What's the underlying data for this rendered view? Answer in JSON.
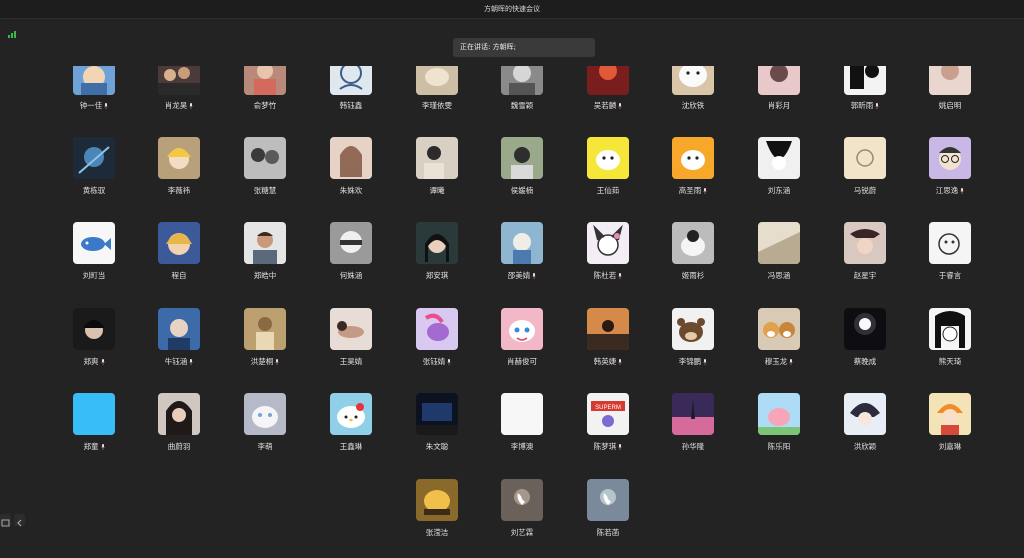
{
  "window": {
    "title": "方朝晖的快速会议"
  },
  "speaking": {
    "label": "正在讲话: 方朝晖;"
  },
  "participants": [
    {
      "name": "钟一佳",
      "mic": true,
      "avatar": "cartoon-photo"
    },
    {
      "name": "肖龙昊",
      "mic": true,
      "avatar": "group-photo"
    },
    {
      "name": "俞梦竹",
      "mic": false,
      "avatar": "person-photo"
    },
    {
      "name": "韩钰鑫",
      "mic": false,
      "avatar": "sketch-drawing"
    },
    {
      "name": "李瑾依雯",
      "mic": false,
      "avatar": "cat-photo"
    },
    {
      "name": "魏雪颖",
      "mic": false,
      "avatar": "grey-photo"
    },
    {
      "name": "吴若麟",
      "mic": true,
      "avatar": "red-photo"
    },
    {
      "name": "沈欣铁",
      "mic": false,
      "avatar": "white-dog"
    },
    {
      "name": "肖彩月",
      "mic": false,
      "avatar": "pink-photo"
    },
    {
      "name": "郭昕雨",
      "mic": true,
      "avatar": "black-white-drawing"
    },
    {
      "name": "姚启明",
      "mic": false,
      "avatar": "light-photo"
    },
    {
      "name": "黄栋驭",
      "mic": false,
      "avatar": "blue-dark-photo"
    },
    {
      "name": "李薇祎",
      "mic": false,
      "avatar": "yellow-hair-anime"
    },
    {
      "name": "张糖慧",
      "mic": false,
      "avatar": "couple-photo"
    },
    {
      "name": "朱姝欢",
      "mic": false,
      "avatar": "girl-photo"
    },
    {
      "name": "谭曦",
      "mic": false,
      "avatar": "person-selfie"
    },
    {
      "name": "侯媛楠",
      "mic": false,
      "avatar": "girl-green"
    },
    {
      "name": "王仙茹",
      "mic": false,
      "avatar": "yellow-cartoon"
    },
    {
      "name": "高圣雨",
      "mic": true,
      "avatar": "orange-cartoon"
    },
    {
      "name": "刘东涵",
      "mic": false,
      "avatar": "manga-face"
    },
    {
      "name": "马锐蔚",
      "mic": false,
      "avatar": "beige-doodle"
    },
    {
      "name": "江思逸",
      "mic": true,
      "avatar": "glasses-drawing"
    },
    {
      "name": "刘町当",
      "mic": false,
      "avatar": "blue-fish"
    },
    {
      "name": "程自",
      "mic": false,
      "avatar": "cartoon-girl"
    },
    {
      "name": "郑皓中",
      "mic": false,
      "avatar": "man-photo"
    },
    {
      "name": "何姝涵",
      "mic": false,
      "avatar": "white-hair"
    },
    {
      "name": "郑安琪",
      "mic": false,
      "avatar": "dark-anime"
    },
    {
      "name": "邵美婧",
      "mic": true,
      "avatar": "doll-photo"
    },
    {
      "name": "陈杜若",
      "mic": true,
      "avatar": "kuromi"
    },
    {
      "name": "姬雨杉",
      "mic": false,
      "avatar": "bw-animal"
    },
    {
      "name": "冯思涵",
      "mic": false,
      "avatar": "cream-photo"
    },
    {
      "name": "赵星宇",
      "mic": false,
      "avatar": "rose-photo"
    },
    {
      "name": "于睿言",
      "mic": false,
      "avatar": "sketch-dog"
    },
    {
      "name": "郑爽",
      "mic": true,
      "avatar": "dark-boy"
    },
    {
      "name": "牛钰涵",
      "mic": true,
      "avatar": "blue-boy"
    },
    {
      "name": "洪楚桐",
      "mic": true,
      "avatar": "tan-photo"
    },
    {
      "name": "王昊婧",
      "mic": false,
      "avatar": "lying-girl"
    },
    {
      "name": "张钰婧",
      "mic": true,
      "avatar": "pony"
    },
    {
      "name": "肖赫俊可",
      "mic": false,
      "avatar": "pink-cartoon"
    },
    {
      "name": "韩英婕",
      "mic": true,
      "avatar": "sunset-photo"
    },
    {
      "name": "李锦鹏",
      "mic": true,
      "avatar": "bear-cartoon"
    },
    {
      "name": "穆玉龙",
      "mic": true,
      "avatar": "shiba-dogs"
    },
    {
      "name": "蔡晚成",
      "mic": false,
      "avatar": "night-light"
    },
    {
      "name": "熊天琦",
      "mic": false,
      "avatar": "manga-girl"
    },
    {
      "name": "郑童",
      "mic": true,
      "avatar": "solid-blue"
    },
    {
      "name": "曲蔚羽",
      "mic": false,
      "avatar": "girl-dark"
    },
    {
      "name": "李萌",
      "mic": false,
      "avatar": "white-cat"
    },
    {
      "name": "王鑫琳",
      "mic": false,
      "avatar": "hello-kitty"
    },
    {
      "name": "朱文聪",
      "mic": false,
      "avatar": "stage-photo"
    },
    {
      "name": "李博澳",
      "mic": false,
      "avatar": "plain-white"
    },
    {
      "name": "陈梦琪",
      "mic": true,
      "avatar": "superman"
    },
    {
      "name": "孙华隆",
      "mic": false,
      "avatar": "pink-sky"
    },
    {
      "name": "陈乐阳",
      "mic": false,
      "avatar": "peppa"
    },
    {
      "name": "洪欣颖",
      "mic": false,
      "avatar": "anime-boy"
    },
    {
      "name": "刘嘉琳",
      "mic": false,
      "avatar": "anime-orange"
    },
    {
      "name": "张滢洁",
      "mic": false,
      "avatar": "bird-cartoon"
    },
    {
      "name": "刘艺霖",
      "mic": false,
      "avatar": "phone-call"
    },
    {
      "name": "陈若菡",
      "mic": false,
      "avatar": "phone-call-2"
    }
  ],
  "colors": {
    "background": "#232323",
    "titlebar": "#1d1d1d",
    "signal": "#3cb84a",
    "speaking_bg": "#3a3a3a"
  }
}
